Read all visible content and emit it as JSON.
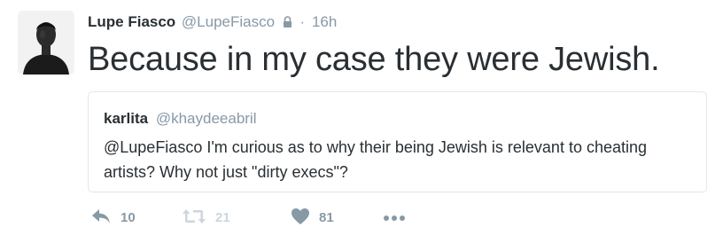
{
  "tweet": {
    "author": {
      "name": "Lupe Fiasco",
      "handle": "@LupeFiasco",
      "avatar_icon": "user-avatar"
    },
    "lock_icon": "lock-icon",
    "separator": "·",
    "time": "16h",
    "text": "Because in my case they were Jewish."
  },
  "quoted_tweet": {
    "author": {
      "name": "karlita",
      "handle": "@khaydeeabril"
    },
    "text": "@LupeFiasco I'm curious as to why their being Jewish is relevant to cheating artists? Why not just \"dirty execs\"?"
  },
  "actions": {
    "reply": {
      "icon": "reply-icon",
      "count": "10"
    },
    "retweet": {
      "icon": "retweet-icon",
      "count": "21"
    },
    "like": {
      "icon": "heart-icon",
      "count": "81"
    },
    "more": {
      "icon": "more-icon"
    }
  },
  "colors": {
    "text": "#292f33",
    "secondary": "#8899a6",
    "border": "#e1e8ed",
    "disabled": "#ccd6dd"
  }
}
